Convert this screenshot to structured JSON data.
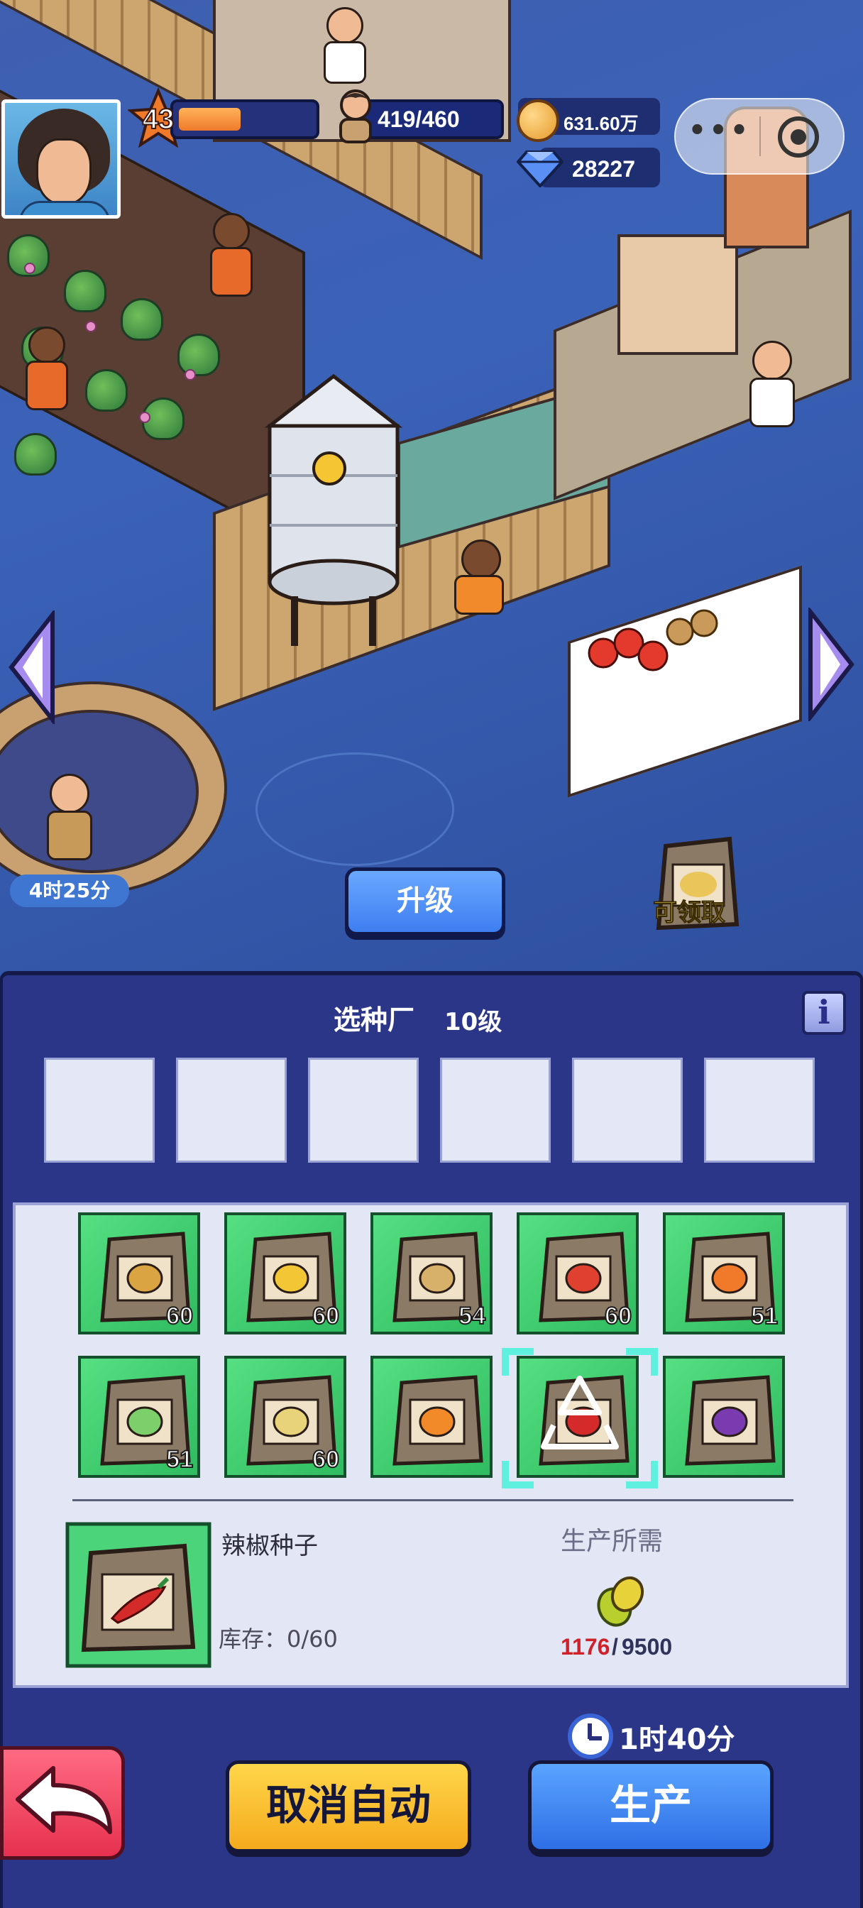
{
  "hud": {
    "level": "43",
    "xp_fraction": 0.47,
    "population": "419/460",
    "coins": "631.60万",
    "gems": "28227"
  },
  "scene": {
    "timer": "4时25分",
    "upgrade_label": "升级",
    "claim_label": "可领取"
  },
  "panel": {
    "title": "选种厂",
    "level": "10级",
    "info_label": "i",
    "empty_slots": 6,
    "seeds": [
      {
        "name": "wheat-seed",
        "count": "60",
        "color": "#d9a441"
      },
      {
        "name": "corn-seed",
        "count": "60",
        "color": "#f2c634"
      },
      {
        "name": "potato-seed",
        "count": "54",
        "color": "#d7b06a"
      },
      {
        "name": "tomato-seed",
        "count": "60",
        "color": "#e0402f"
      },
      {
        "name": "carrot-seed",
        "count": "51",
        "color": "#f07a2a"
      },
      {
        "name": "cabbage-seed",
        "count": "51",
        "color": "#7ccf6a"
      },
      {
        "name": "soybean-seed",
        "count": "60",
        "color": "#e8d27a"
      },
      {
        "name": "pumpkin-seed",
        "count": "",
        "color": "#f28a2a"
      },
      {
        "name": "chili-seed",
        "count": "",
        "color": "#d42a2a"
      },
      {
        "name": "eggplant-seed",
        "count": "",
        "color": "#7a3ab0"
      }
    ],
    "selected": {
      "name": "辣椒种子",
      "stock": "库存：0/60"
    },
    "requirement": {
      "title": "生产所需",
      "have": "1176",
      "sep": "/",
      "need": "9500",
      "icon": "soybean-icon"
    },
    "time": "1时40分",
    "cancel_auto_label": "取消自动",
    "produce_label": "生产"
  }
}
